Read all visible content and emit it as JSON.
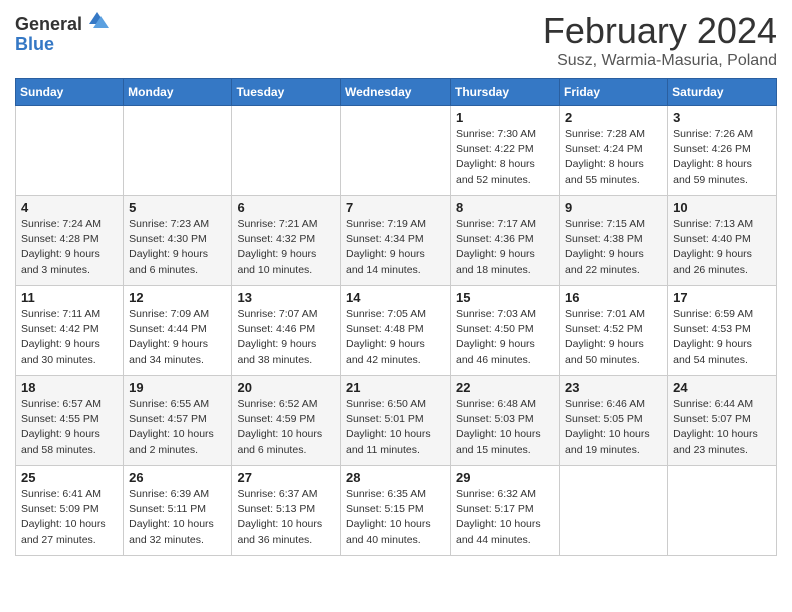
{
  "logo": {
    "general": "General",
    "blue": "Blue"
  },
  "title": "February 2024",
  "location": "Susz, Warmia-Masuria, Poland",
  "days_header": [
    "Sunday",
    "Monday",
    "Tuesday",
    "Wednesday",
    "Thursday",
    "Friday",
    "Saturday"
  ],
  "weeks": [
    [
      {
        "day": "",
        "info": ""
      },
      {
        "day": "",
        "info": ""
      },
      {
        "day": "",
        "info": ""
      },
      {
        "day": "",
        "info": ""
      },
      {
        "day": "1",
        "info": "Sunrise: 7:30 AM\nSunset: 4:22 PM\nDaylight: 8 hours\nand 52 minutes."
      },
      {
        "day": "2",
        "info": "Sunrise: 7:28 AM\nSunset: 4:24 PM\nDaylight: 8 hours\nand 55 minutes."
      },
      {
        "day": "3",
        "info": "Sunrise: 7:26 AM\nSunset: 4:26 PM\nDaylight: 8 hours\nand 59 minutes."
      }
    ],
    [
      {
        "day": "4",
        "info": "Sunrise: 7:24 AM\nSunset: 4:28 PM\nDaylight: 9 hours\nand 3 minutes."
      },
      {
        "day": "5",
        "info": "Sunrise: 7:23 AM\nSunset: 4:30 PM\nDaylight: 9 hours\nand 6 minutes."
      },
      {
        "day": "6",
        "info": "Sunrise: 7:21 AM\nSunset: 4:32 PM\nDaylight: 9 hours\nand 10 minutes."
      },
      {
        "day": "7",
        "info": "Sunrise: 7:19 AM\nSunset: 4:34 PM\nDaylight: 9 hours\nand 14 minutes."
      },
      {
        "day": "8",
        "info": "Sunrise: 7:17 AM\nSunset: 4:36 PM\nDaylight: 9 hours\nand 18 minutes."
      },
      {
        "day": "9",
        "info": "Sunrise: 7:15 AM\nSunset: 4:38 PM\nDaylight: 9 hours\nand 22 minutes."
      },
      {
        "day": "10",
        "info": "Sunrise: 7:13 AM\nSunset: 4:40 PM\nDaylight: 9 hours\nand 26 minutes."
      }
    ],
    [
      {
        "day": "11",
        "info": "Sunrise: 7:11 AM\nSunset: 4:42 PM\nDaylight: 9 hours\nand 30 minutes."
      },
      {
        "day": "12",
        "info": "Sunrise: 7:09 AM\nSunset: 4:44 PM\nDaylight: 9 hours\nand 34 minutes."
      },
      {
        "day": "13",
        "info": "Sunrise: 7:07 AM\nSunset: 4:46 PM\nDaylight: 9 hours\nand 38 minutes."
      },
      {
        "day": "14",
        "info": "Sunrise: 7:05 AM\nSunset: 4:48 PM\nDaylight: 9 hours\nand 42 minutes."
      },
      {
        "day": "15",
        "info": "Sunrise: 7:03 AM\nSunset: 4:50 PM\nDaylight: 9 hours\nand 46 minutes."
      },
      {
        "day": "16",
        "info": "Sunrise: 7:01 AM\nSunset: 4:52 PM\nDaylight: 9 hours\nand 50 minutes."
      },
      {
        "day": "17",
        "info": "Sunrise: 6:59 AM\nSunset: 4:53 PM\nDaylight: 9 hours\nand 54 minutes."
      }
    ],
    [
      {
        "day": "18",
        "info": "Sunrise: 6:57 AM\nSunset: 4:55 PM\nDaylight: 9 hours\nand 58 minutes."
      },
      {
        "day": "19",
        "info": "Sunrise: 6:55 AM\nSunset: 4:57 PM\nDaylight: 10 hours\nand 2 minutes."
      },
      {
        "day": "20",
        "info": "Sunrise: 6:52 AM\nSunset: 4:59 PM\nDaylight: 10 hours\nand 6 minutes."
      },
      {
        "day": "21",
        "info": "Sunrise: 6:50 AM\nSunset: 5:01 PM\nDaylight: 10 hours\nand 11 minutes."
      },
      {
        "day": "22",
        "info": "Sunrise: 6:48 AM\nSunset: 5:03 PM\nDaylight: 10 hours\nand 15 minutes."
      },
      {
        "day": "23",
        "info": "Sunrise: 6:46 AM\nSunset: 5:05 PM\nDaylight: 10 hours\nand 19 minutes."
      },
      {
        "day": "24",
        "info": "Sunrise: 6:44 AM\nSunset: 5:07 PM\nDaylight: 10 hours\nand 23 minutes."
      }
    ],
    [
      {
        "day": "25",
        "info": "Sunrise: 6:41 AM\nSunset: 5:09 PM\nDaylight: 10 hours\nand 27 minutes."
      },
      {
        "day": "26",
        "info": "Sunrise: 6:39 AM\nSunset: 5:11 PM\nDaylight: 10 hours\nand 32 minutes."
      },
      {
        "day": "27",
        "info": "Sunrise: 6:37 AM\nSunset: 5:13 PM\nDaylight: 10 hours\nand 36 minutes."
      },
      {
        "day": "28",
        "info": "Sunrise: 6:35 AM\nSunset: 5:15 PM\nDaylight: 10 hours\nand 40 minutes."
      },
      {
        "day": "29",
        "info": "Sunrise: 6:32 AM\nSunset: 5:17 PM\nDaylight: 10 hours\nand 44 minutes."
      },
      {
        "day": "",
        "info": ""
      },
      {
        "day": "",
        "info": ""
      }
    ]
  ]
}
